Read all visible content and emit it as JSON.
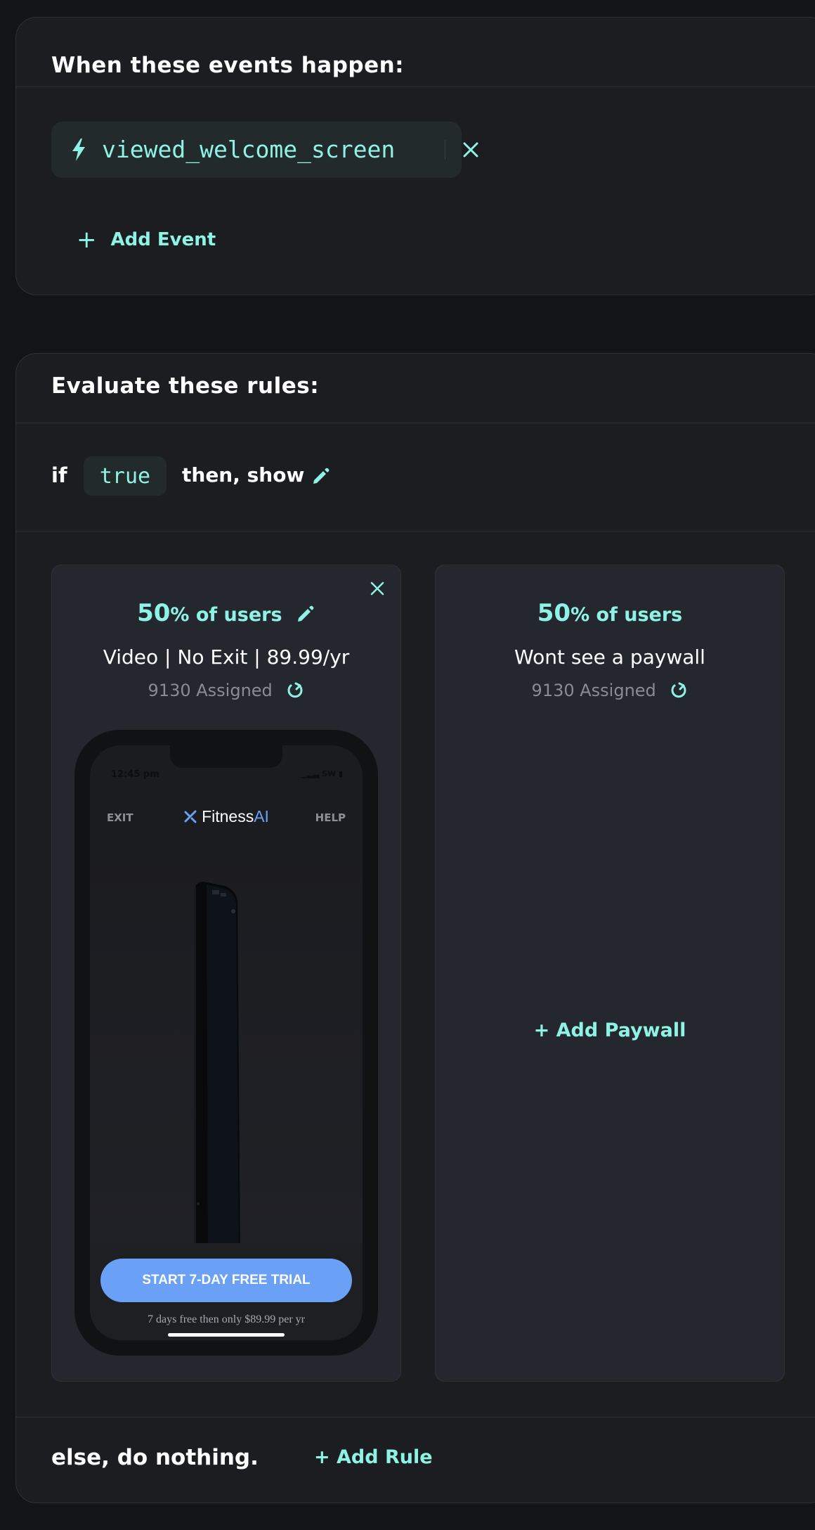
{
  "events_section": {
    "title": "When these events happen:",
    "events": [
      {
        "name": "viewed_welcome_screen"
      }
    ],
    "add_event_plus": "+",
    "add_event_label": "Add Event"
  },
  "rules_section": {
    "title": "Evaluate these rules:",
    "if_keyword": "if",
    "condition": "true",
    "then_label": "then, show",
    "variants": [
      {
        "pct_value": "50",
        "pct_suffix": "% of users",
        "name": "Video | No Exit | 89.99/yr",
        "assigned": "9130 Assigned",
        "paywall_preview": {
          "status_time": "12:45 pm",
          "status_right": "▁▂▃ SW ▮",
          "exit_label": "EXIT",
          "help_label": "HELP",
          "brand_main": "Fitness",
          "brand_accent": "AI",
          "cta_label": "START 7-DAY FREE TRIAL",
          "cta_subtext": "7 days free then only $89.99 per yr"
        }
      },
      {
        "pct_value": "50",
        "pct_suffix": "% of users",
        "name": "Wont see a paywall",
        "assigned": "9130 Assigned",
        "add_paywall_label": "+ Add Paywall"
      }
    ],
    "else_text": "else, do nothing.",
    "add_rule_label": "+ Add Rule"
  },
  "colors": {
    "background": "#131417",
    "card": "#1c1d21",
    "panel": "#25272e",
    "accent_teal": "#8ef3e4",
    "chip_bg": "#232a2c",
    "cta_blue": "#6aa0f6",
    "muted_text": "#8a8c92"
  },
  "icons": {
    "event_chip": "bolt-icon",
    "event_remove": "close-icon",
    "edit": "pencil-icon",
    "refresh": "refresh-icon",
    "panel_close": "close-icon",
    "brand_logo": "fitness-logo-icon"
  }
}
